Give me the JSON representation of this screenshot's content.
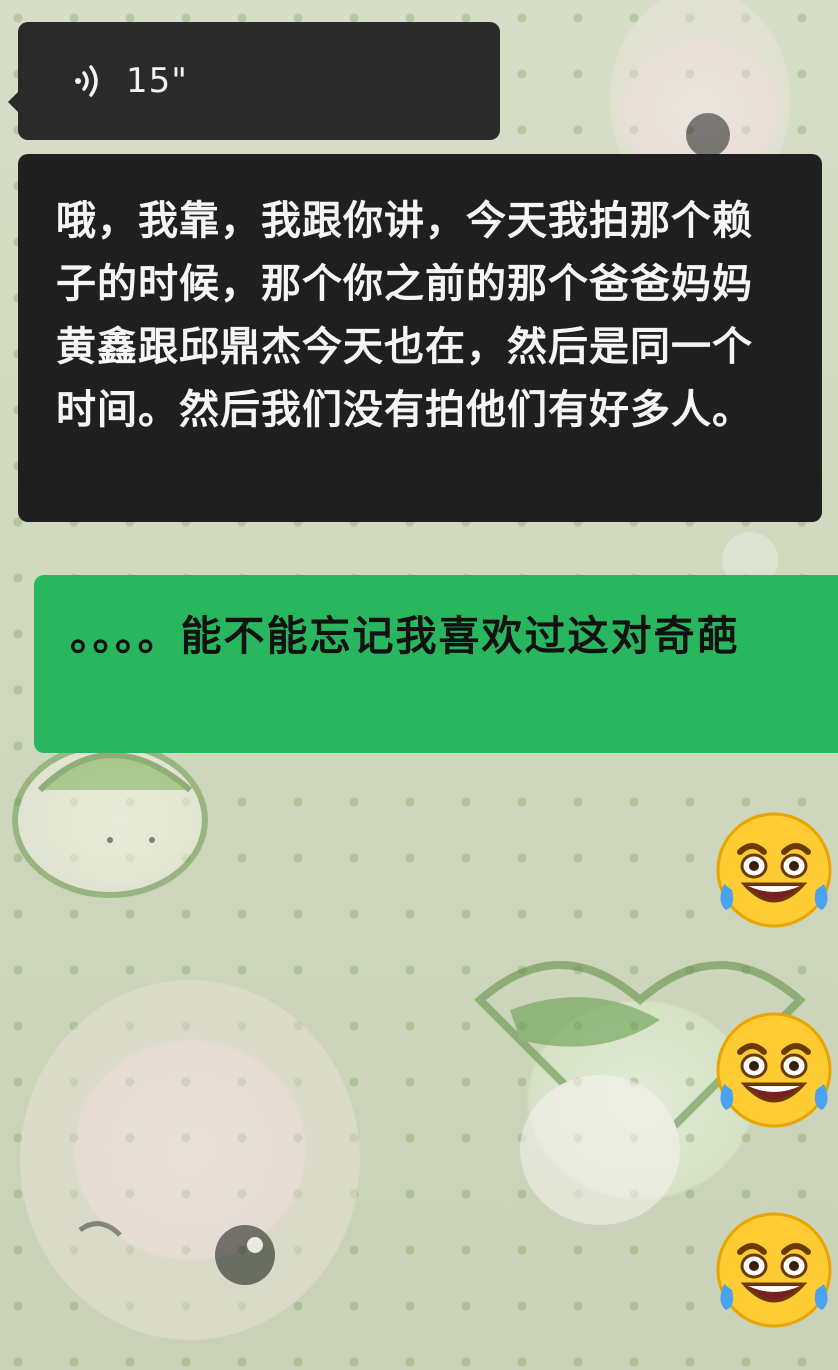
{
  "messages": {
    "voice": {
      "duration": "15\"",
      "icon": "voice-wave-icon"
    },
    "transcript": {
      "text": "哦，我靠，我跟你讲，今天我拍那个赖子的时候，那个你之前的那个爸爸妈妈黄鑫跟邱鼎杰今天也在，然后是同一个时间。然后我们没有拍他们有好多人。"
    },
    "sent": {
      "text": "。。。。能不能忘记我喜欢过这对奇葩"
    },
    "emojis": [
      "laughing-crying-emoji",
      "laughing-crying-emoji",
      "laughing-crying-emoji"
    ]
  },
  "colors": {
    "dark_bubble": "#2a2a2a",
    "transcript_bg": "#1f1f1f",
    "sent_bubble": "#28b75f"
  }
}
